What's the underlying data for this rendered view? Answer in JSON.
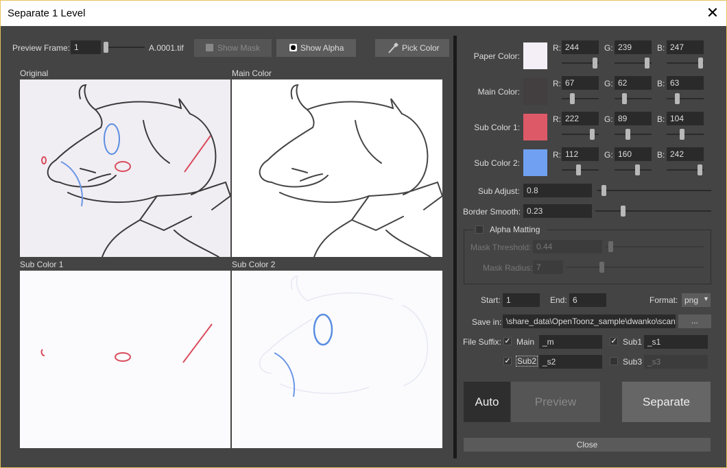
{
  "window": {
    "title": "Separate 1 Level"
  },
  "preview": {
    "frame_label": "Preview Frame:",
    "frame_value": "1",
    "frame_slider": 0.0,
    "file_name": "A.0001.tif",
    "show_mask_label": "Show Mask",
    "show_alpha_label": "Show Alpha",
    "pick_color_label": "Pick Color",
    "panels": [
      "Original",
      "Main Color",
      "Sub Color 1",
      "Sub Color 2"
    ]
  },
  "colors": {
    "rows": [
      {
        "label": "Paper Color:",
        "swatch": "#f4eff7",
        "r": "244",
        "g": "239",
        "b": "247",
        "r_pos": 0.96,
        "g_pos": 0.94,
        "b_pos": 0.97
      },
      {
        "label": "Main Color:",
        "swatch": "#433e3f",
        "r": "67",
        "g": "62",
        "b": "63",
        "r_pos": 0.26,
        "g_pos": 0.24,
        "b_pos": 0.25
      },
      {
        "label": "Sub Color 1:",
        "swatch": "#de5968",
        "r": "222",
        "g": "89",
        "b": "104",
        "r_pos": 0.87,
        "g_pos": 0.35,
        "b_pos": 0.41
      },
      {
        "label": "Sub Color 2:",
        "swatch": "#70a0f2",
        "r": "112",
        "g": "160",
        "b": "242",
        "r_pos": 0.44,
        "g_pos": 0.63,
        "b_pos": 0.95
      }
    ],
    "r_label": "R:",
    "g_label": "G:",
    "b_label": "B:"
  },
  "adjust": {
    "sub_adjust_label": "Sub Adjust:",
    "sub_adjust_value": "0.8",
    "sub_adjust_pos": 0.04,
    "border_smooth_label": "Border Smooth:",
    "border_smooth_value": "0.23",
    "border_smooth_pos": 0.23
  },
  "alpha_matting": {
    "label": "Alpha Matting",
    "checked": false,
    "mask_threshold_label": "Mask Threshold:",
    "mask_threshold_value": "0.44",
    "mask_threshold_pos": 0.03,
    "mask_radius_label": "Mask Radius:",
    "mask_radius_value": "7",
    "mask_radius_pos": 0.25
  },
  "output": {
    "start_label": "Start:",
    "start_value": "1",
    "end_label": "End:",
    "end_value": "6",
    "format_label": "Format:",
    "format_value": "png",
    "save_in_label": "Save in:",
    "save_in_value": "\\share_data\\OpenToonz_sample\\dwanko\\scan",
    "browse_label": "...",
    "file_suffix_label": "File Suffix:",
    "main_label": "Main",
    "main_value": "_m",
    "sub1_label": "Sub1",
    "sub1_value": "_s1",
    "sub2_label": "Sub2",
    "sub2_value": "_s2",
    "sub3_label": "Sub3",
    "sub3_value": "_s3"
  },
  "actions": {
    "auto_label": "Auto",
    "preview_label": "Preview",
    "separate_label": "Separate",
    "close_label": "Close"
  }
}
